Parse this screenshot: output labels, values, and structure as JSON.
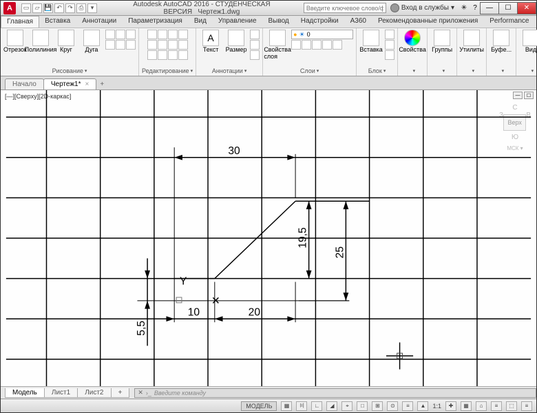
{
  "titlebar": {
    "logo": "A",
    "app_title": "Autodesk AutoCAD 2016 - СТУДЕНЧЕСКАЯ ВЕРСИЯ",
    "doc_title": "Чертеж1.dwg",
    "search_placeholder": "Введите ключевое слово/фразу",
    "login_label": "Вход в службы",
    "win_min": "—",
    "win_max": "☐",
    "win_close": "✕"
  },
  "menubar": {
    "tabs": [
      "Главная",
      "Вставка",
      "Аннотации",
      "Параметризация",
      "Вид",
      "Управление",
      "Вывод",
      "Надстройки",
      "A360",
      "Рекомендованные приложения",
      "Performance"
    ],
    "active": 0
  },
  "ribbon": {
    "panel_draw": {
      "name": "Рисование",
      "btns": [
        "Отрезок",
        "Полилиния",
        "Круг",
        "Дуга"
      ]
    },
    "panel_edit": {
      "name": "Редактирование"
    },
    "panel_annot": {
      "name": "Аннотации",
      "btns": [
        "Текст",
        "Размер"
      ]
    },
    "panel_layers": {
      "name": "Слои",
      "btn": "Свойства слоя",
      "current": "0"
    },
    "panel_block": {
      "name": "Блок",
      "btn": "Вставка"
    },
    "panel_props": {
      "name": "Свойства"
    },
    "panel_groups": {
      "name": "Группы"
    },
    "panel_util": {
      "name": "Утилиты"
    },
    "panel_clip": {
      "name": "Буфе..."
    },
    "panel_view": {
      "name": "Вид"
    }
  },
  "filetabs": {
    "tabs": [
      "Начало",
      "Чертеж1*"
    ],
    "active": 1,
    "close": "×",
    "plus": "+"
  },
  "canvas": {
    "view_label": "[—][Сверху][2D-каркас]",
    "viewcube": {
      "n": "С",
      "s": "Ю",
      "w": "З",
      "e": "В",
      "top": "Верх",
      "wcs": "МСК ▾"
    }
  },
  "dimensions": {
    "d30": "30",
    "d19_5": "19,5",
    "d25": "25",
    "d10": "10",
    "d20": "20",
    "d5_5": "5,5"
  },
  "modeltabs": {
    "tabs": [
      "Модель",
      "Лист1",
      "Лист2"
    ],
    "active": 0,
    "plus": "+"
  },
  "cmdline": {
    "prompt": "›_",
    "placeholder": "Введите команду"
  },
  "statusbar": {
    "model": "МОДЕЛЬ",
    "scale": "1:1",
    "icons": [
      "▦",
      "〣",
      "∟",
      "◢",
      "⌖",
      "□",
      "⊞",
      "⊙",
      "≡",
      "▲",
      "✚",
      "▦",
      "⌂",
      "≡",
      "◉",
      "⬚",
      "≡"
    ]
  }
}
